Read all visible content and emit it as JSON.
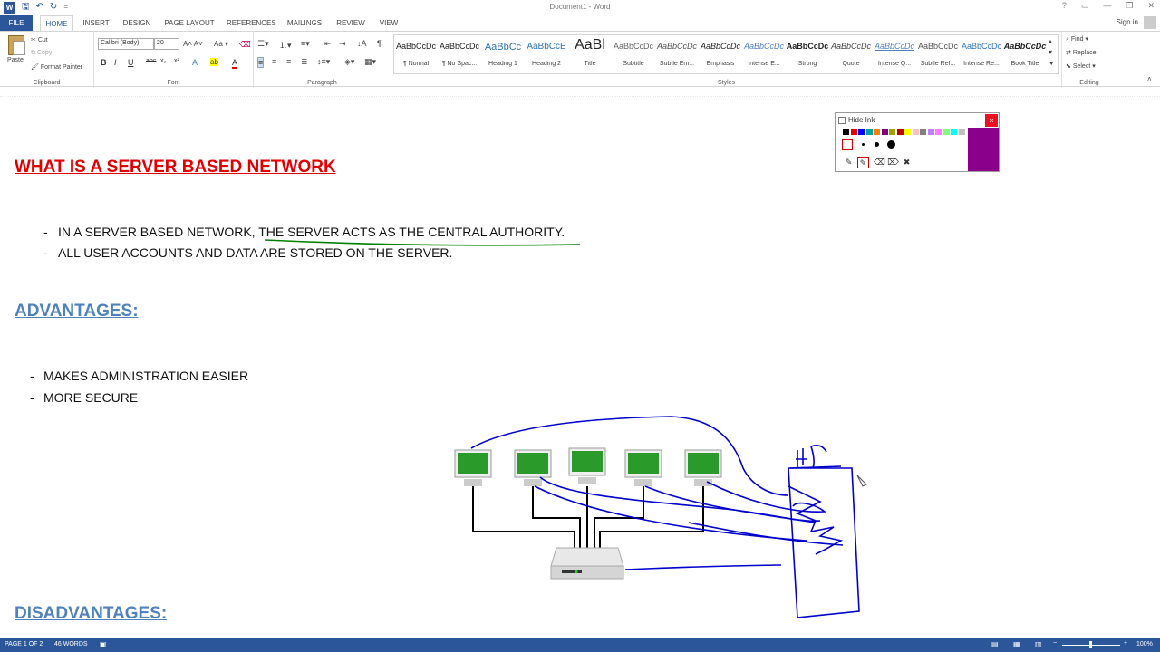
{
  "titlebar": {
    "title": "Document1 - Word",
    "controls": [
      "?",
      "▭",
      "—",
      "❐",
      "✕"
    ]
  },
  "tabs": {
    "file": "FILE",
    "items": [
      "HOME",
      "INSERT",
      "DESIGN",
      "PAGE LAYOUT",
      "REFERENCES",
      "MAILINGS",
      "REVIEW",
      "VIEW"
    ],
    "signin": "Sign in"
  },
  "ribbon": {
    "clipboard": {
      "paste": "Paste",
      "cut": "Cut",
      "copy": "Copy",
      "format_painter": "Format Painter",
      "label": "Clipboard"
    },
    "font": {
      "name": "Calibri (Body)",
      "size": "20",
      "label": "Font"
    },
    "paragraph": {
      "label": "Paragraph"
    },
    "styles": {
      "label": "Styles",
      "items": [
        {
          "sample": "AaBbCcDc",
          "name": "¶ Normal"
        },
        {
          "sample": "AaBbCcDc",
          "name": "¶ No Spac..."
        },
        {
          "sample": "AaBbCc",
          "name": "Heading 1"
        },
        {
          "sample": "AaBbCcE",
          "name": "Heading 2"
        },
        {
          "sample": "AaBl",
          "name": "Title"
        },
        {
          "sample": "AaBbCcDc",
          "name": "Subtitle"
        },
        {
          "sample": "AaBbCcDc",
          "name": "Subtle Em..."
        },
        {
          "sample": "AaBbCcDc",
          "name": "Emphasis"
        },
        {
          "sample": "AaBbCcDc",
          "name": "Intense E..."
        },
        {
          "sample": "AaBbCcDc",
          "name": "Strong"
        },
        {
          "sample": "AaBbCcDc",
          "name": "Quote"
        },
        {
          "sample": "AaBbCcDc",
          "name": "Intense Q..."
        },
        {
          "sample": "AaBbCcDc",
          "name": "Subtle Ref..."
        },
        {
          "sample": "AaBbCcDc",
          "name": "Intense Re..."
        },
        {
          "sample": "AaBbCcDc",
          "name": "Book Title"
        }
      ]
    },
    "editing": {
      "find": "Find",
      "replace": "Replace",
      "select": "Select",
      "label": "Editing"
    }
  },
  "document": {
    "heading": "WHAT IS A SERVER BASED NETWORK",
    "intro_bullets": [
      "IN A SERVER BASED NETWORK, THE SERVER ACTS AS THE CENTRAL AUTHORITY.",
      "ALL USER ACCOUNTS AND DATA ARE STORED ON THE SERVER."
    ],
    "advantages_heading": "ADVANTAGES:",
    "advantages": [
      "MAKES ADMINISTRATION EASIER",
      "MORE SECURE"
    ],
    "disadvantages_heading": "DISADVANTAGES:",
    "ink_annotation": "HP"
  },
  "ink_toolbar": {
    "hide_ink": "Hide Ink",
    "close": "×",
    "current_color": "#8b008b",
    "palette": [
      "#000000",
      "#e00000",
      "#0000ff",
      "#00a0a0",
      "#ff8000",
      "#800080",
      "#a0a000",
      "#c00000",
      "#ffff00",
      "#ffc0c0",
      "#808080",
      "#c080ff",
      "#ff80ff",
      "#80ff80",
      "#00ffff",
      "#c0c0c0"
    ]
  },
  "statusbar": {
    "page": "PAGE 1 OF 2",
    "words": "46 WORDS",
    "zoom": "100%"
  },
  "colors": {
    "accent": "#2b579a",
    "heading_red": "#e00000",
    "heading_blue": "#4f81bd",
    "ink_green": "#008000",
    "ink_blue": "#0000cc"
  }
}
